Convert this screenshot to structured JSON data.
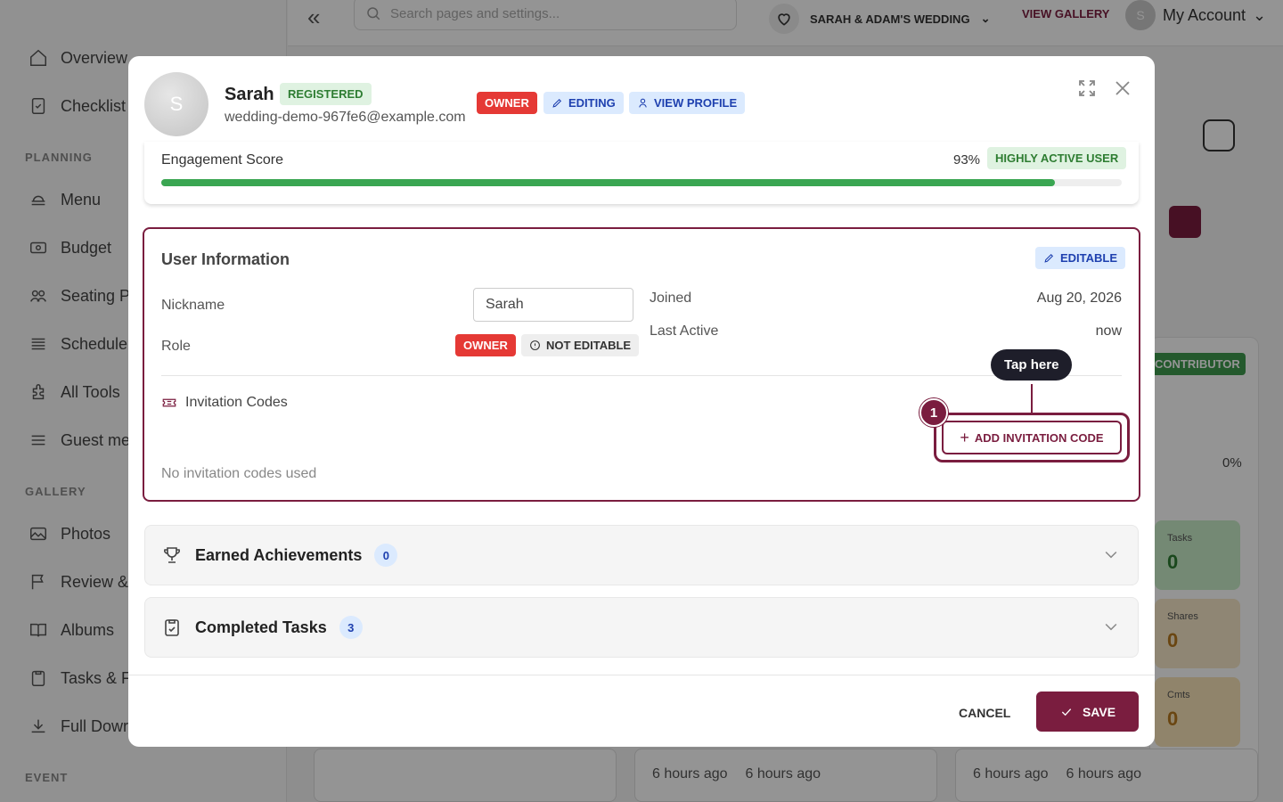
{
  "colors": {
    "brand": "#7a1d3f",
    "owner_red": "#e53935",
    "success_green": "#3aa652",
    "info_blue": "#1e40af"
  },
  "sidebar": {
    "items": [
      {
        "label": "Overview",
        "icon": "home-icon"
      },
      {
        "label": "Checklist",
        "icon": "checklist-icon"
      },
      {
        "label": "Menu",
        "icon": "menu-food-icon"
      },
      {
        "label": "Budget",
        "icon": "budget-icon"
      },
      {
        "label": "Seating P",
        "icon": "seating-icon"
      },
      {
        "label": "Schedule",
        "icon": "schedule-icon"
      },
      {
        "label": "All Tools",
        "icon": "tools-icon"
      },
      {
        "label": "Guest me",
        "icon": "guest-menu-icon"
      },
      {
        "label": "Photos",
        "icon": "photo-icon"
      },
      {
        "label": "Review &",
        "icon": "flag-icon"
      },
      {
        "label": "Albums",
        "icon": "book-icon"
      },
      {
        "label": "Tasks & F",
        "icon": "clipboard-icon"
      },
      {
        "label": "Full Dowr",
        "icon": "download-icon"
      }
    ],
    "sections": {
      "planning": "PLANNING",
      "gallery": "GALLERY",
      "event": "EVENT"
    }
  },
  "topbar": {
    "search_placeholder": "Search pages and settings...",
    "wedding_name": "SARAH & ADAM'S WEDDING",
    "view_gallery": "VIEW GALLERY",
    "account_label": "My Account",
    "account_initial": "S"
  },
  "background": {
    "contributor_badge": "CONTRIBUTOR",
    "progress_pct": "0%",
    "stats": [
      {
        "label": "Tasks",
        "value": "0"
      },
      {
        "label": "Shares",
        "value": "0"
      },
      {
        "label": "Cmts",
        "value": "0"
      }
    ],
    "time_ago": "6 hours ago"
  },
  "modal": {
    "user": {
      "initial": "S",
      "name": "Sarah",
      "status": "REGISTERED",
      "email": "wedding-demo-967fe6@example.com"
    },
    "header_badges": {
      "owner": "OWNER",
      "editing": "EDITING",
      "view_profile": "VIEW PROFILE"
    },
    "engagement": {
      "label": "Engagement Score",
      "score_percent": 93,
      "score_label": "93%",
      "badge": "HIGHLY ACTIVE USER"
    },
    "user_info": {
      "title": "User Information",
      "editable_badge": "EDITABLE",
      "nickname_label": "Nickname",
      "nickname_value": "Sarah",
      "role_label": "Role",
      "role_value": "OWNER",
      "not_editable": "NOT EDITABLE",
      "joined_label": "Joined",
      "joined_value": "Aug 20, 2026",
      "last_active_label": "Last Active",
      "last_active_value": "now",
      "invitation_title": "Invitation Codes",
      "no_codes": "No invitation codes used",
      "add_code_button": "ADD INVITATION CODE"
    },
    "tutorial": {
      "tooltip": "Tap here",
      "step": "1"
    },
    "achievements": {
      "title": "Earned Achievements",
      "count": "0"
    },
    "completed_tasks": {
      "title": "Completed Tasks",
      "count": "3"
    },
    "footer": {
      "cancel": "CANCEL",
      "save": "SAVE"
    }
  }
}
